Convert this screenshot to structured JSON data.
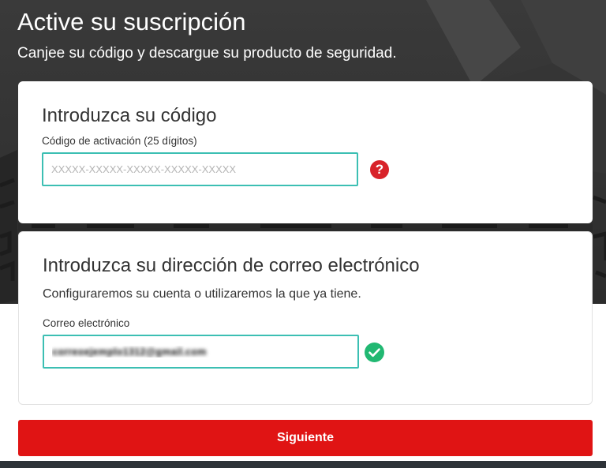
{
  "header": {
    "title": "Active su suscripción",
    "subtitle": "Canjee su código y descargue su producto de seguridad."
  },
  "code_card": {
    "title": "Introduzca su código",
    "field_label": "Código de activación (25 dígitos)",
    "placeholder": "XXXXX-XXXXX-XXXXX-XXXXX-XXXXX",
    "value": "",
    "help_icon": "question-mark-circle-icon",
    "help_glyph": "?"
  },
  "email_card": {
    "title": "Introduzca su dirección de correo electrónico",
    "description": "Configuraremos su cuenta o utilizaremos la que ya tiene.",
    "field_label": "Correo electrónico",
    "value": "correoejemplo1312@gmail.com",
    "valid_icon": "checkmark-circle-icon"
  },
  "next_button": {
    "label": "Siguiente"
  },
  "colors": {
    "hero_background": "#333333",
    "accent_red": "#e01414",
    "help_red": "#d8232a",
    "input_border_teal": "#3cbfb3",
    "valid_green": "#21b872"
  }
}
